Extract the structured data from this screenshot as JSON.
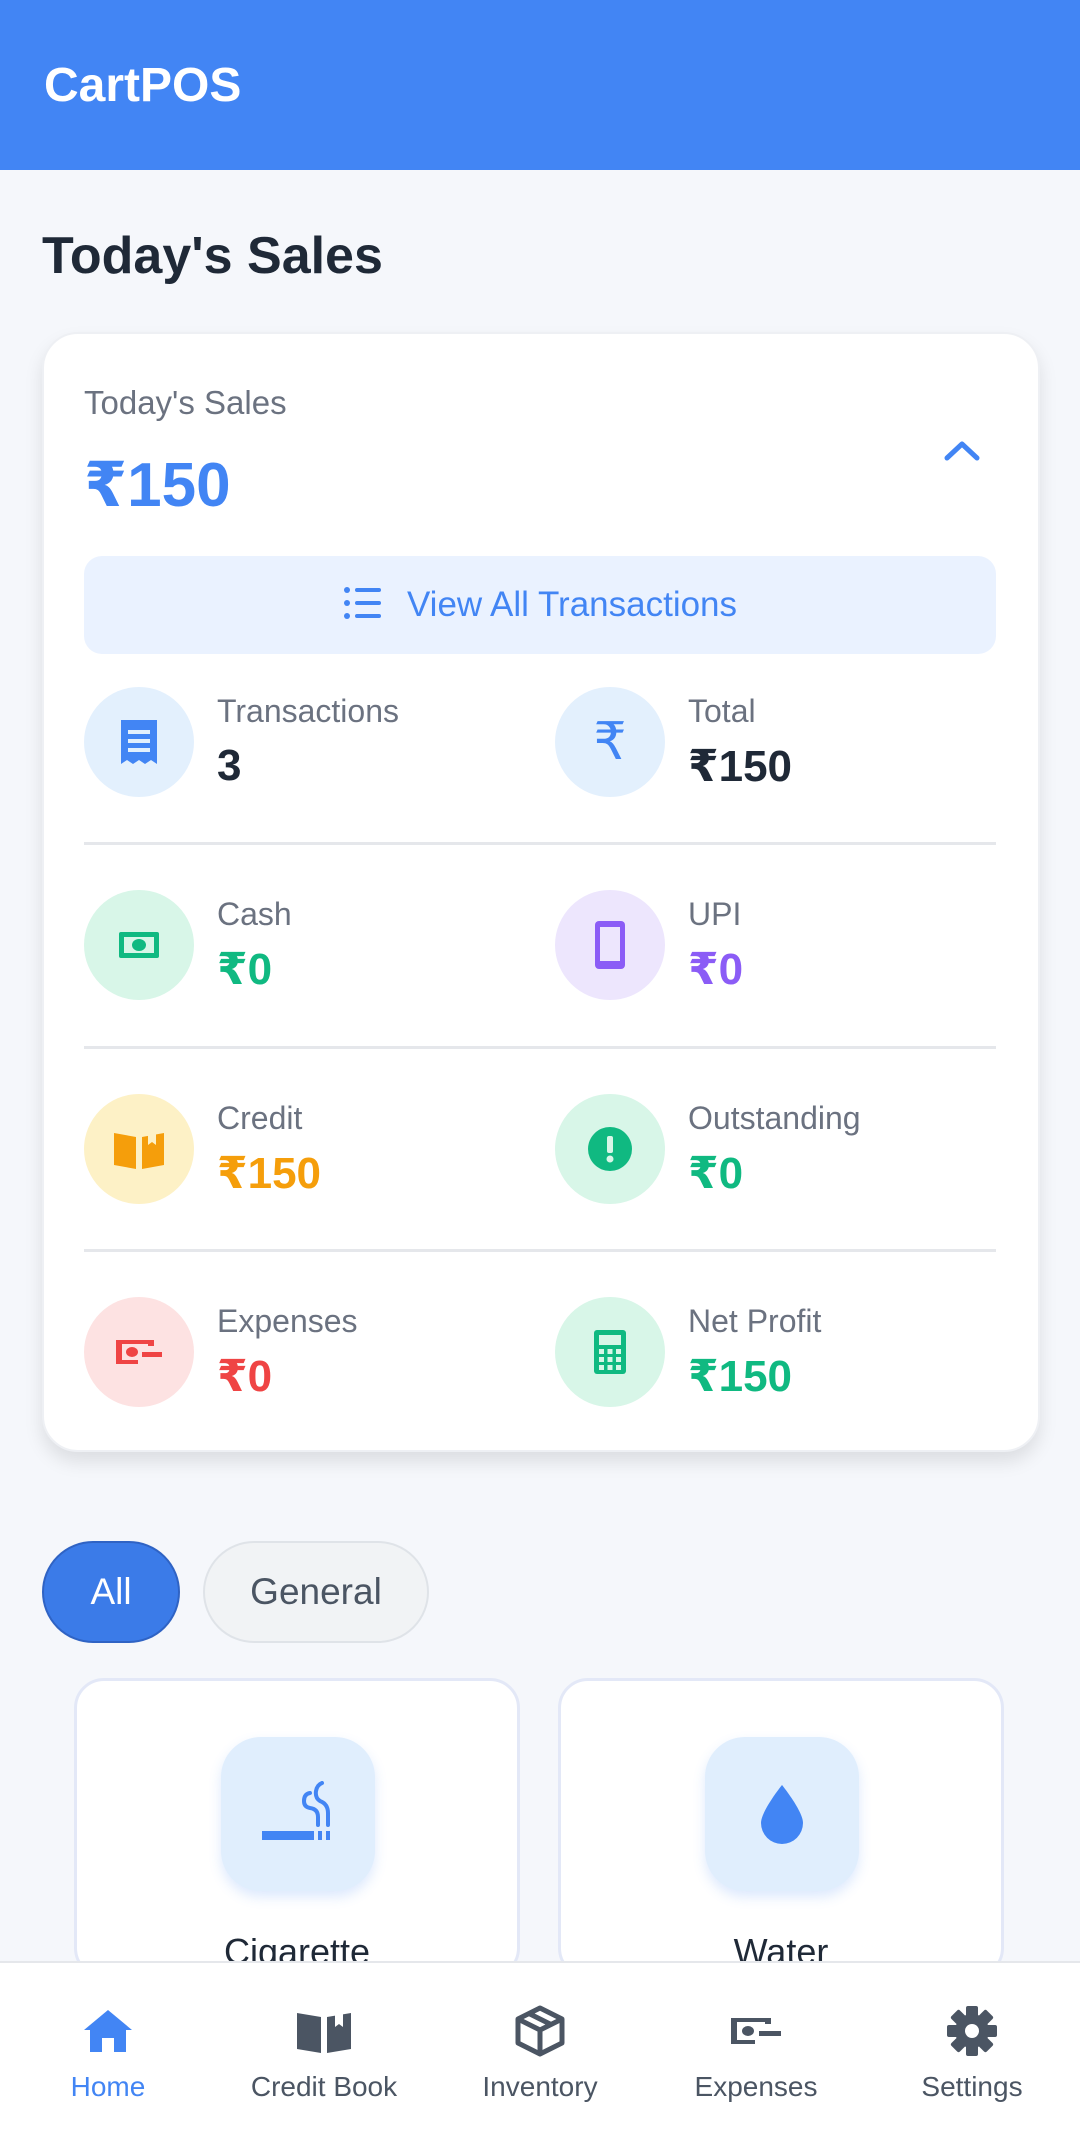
{
  "app": {
    "title": "CartPOS"
  },
  "page": {
    "section_title": "Today's Sales"
  },
  "summary": {
    "label": "Today's Sales",
    "amount": "₹150",
    "view_all_label": "View All Transactions"
  },
  "stats": {
    "transactions": {
      "label": "Transactions",
      "value": "3",
      "icon": "receipt-icon",
      "color": "#1f2937"
    },
    "total": {
      "label": "Total",
      "value": "₹150",
      "icon": "rupee-icon",
      "color": "#1f2937"
    },
    "cash": {
      "label": "Cash",
      "value": "₹0",
      "icon": "cash-icon",
      "color": "#10b981"
    },
    "upi": {
      "label": "UPI",
      "value": "₹0",
      "icon": "phone-icon",
      "color": "#8b5cf6"
    },
    "credit": {
      "label": "Credit",
      "value": "₹150",
      "icon": "book-icon",
      "color": "#f59e0b"
    },
    "outstanding": {
      "label": "Outstanding",
      "value": "₹0",
      "icon": "alert-icon",
      "color": "#10b981"
    },
    "expenses": {
      "label": "Expenses",
      "value": "₹0",
      "icon": "money-off-icon",
      "color": "#ef4444"
    },
    "net_profit": {
      "label": "Net Profit",
      "value": "₹150",
      "icon": "calculator-icon",
      "color": "#10b981"
    }
  },
  "filters": [
    {
      "label": "All",
      "selected": true
    },
    {
      "label": "General",
      "selected": false
    }
  ],
  "products": [
    {
      "name": "Cigarette",
      "icon": "smoking-icon"
    },
    {
      "name": "Water",
      "icon": "water-drop-icon"
    }
  ],
  "nav": [
    {
      "label": "Home",
      "icon": "home-icon",
      "active": true
    },
    {
      "label": "Credit Book",
      "icon": "book-icon",
      "active": false
    },
    {
      "label": "Inventory",
      "icon": "box-icon",
      "active": false
    },
    {
      "label": "Expenses",
      "icon": "money-off-icon",
      "active": false
    },
    {
      "label": "Settings",
      "icon": "gear-icon",
      "active": false
    }
  ],
  "colors": {
    "primary": "#4285f4",
    "green": "#10b981",
    "purple": "#8b5cf6",
    "amber": "#f59e0b",
    "red": "#ef4444"
  }
}
